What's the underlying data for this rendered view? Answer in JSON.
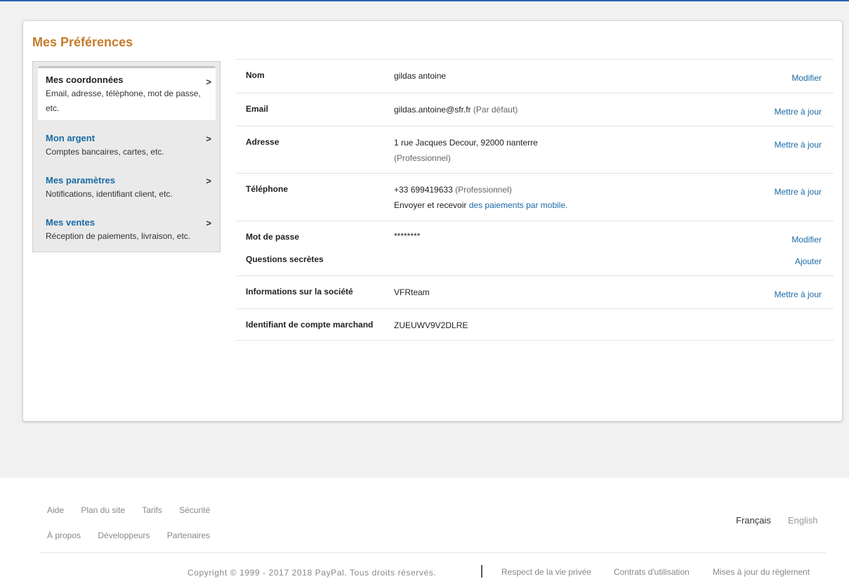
{
  "page": {
    "title": "Mes Préférences"
  },
  "sidebar": {
    "items": [
      {
        "title": "Mes coordonnées",
        "desc": "Email, adresse, téléphone, mot de passe, etc."
      },
      {
        "title": "Mon argent",
        "desc": "Comptes bancaires, cartes, etc."
      },
      {
        "title": "Mes paramètres",
        "desc": "Notifications, identifiant client, etc."
      },
      {
        "title": "Mes ventes",
        "desc": "Réception de paiements, livraison, etc."
      }
    ],
    "chevron": ">"
  },
  "details": {
    "nom": {
      "label": "Nom",
      "value": "gildas antoine",
      "action": "Modifier"
    },
    "email": {
      "label": "Email",
      "value": "gildas.antoine@sfr.fr",
      "note": "(Par défaut)",
      "action": "Mettre à jour"
    },
    "adresse": {
      "label": "Adresse",
      "value": "1 rue Jacques Decour, 92000 nanterre",
      "note": "(Professionnel)",
      "action": "Mettre à jour"
    },
    "telephone": {
      "label": "Téléphone",
      "value": "+33 699419633",
      "note": "(Professionnel)",
      "line2_prefix": "Envoyer et recevoir",
      "line2_link": "des paiements par mobile.",
      "action": "Mettre à jour"
    },
    "mdp": {
      "label": "Mot de passe",
      "value": "********",
      "action": "Modifier"
    },
    "questions": {
      "label": "Questions secrètes",
      "action": "Ajouter"
    },
    "societe": {
      "label": "Informations sur la société",
      "value": "VFRteam",
      "action": "Mettre à jour"
    },
    "marchand": {
      "label": "Identifiant de compte marchand",
      "value": "ZUEUWV9V2DLRE"
    }
  },
  "footer": {
    "links_row1": [
      "Aide",
      "Plan du site",
      "Tarifs",
      "Sécurité"
    ],
    "links_row2": [
      "À propos",
      "Développeurs",
      "Partenaires"
    ],
    "languages": [
      "Français",
      "English"
    ],
    "copyright": "Copyright © 1999 - 2017 2018 PayPal. Tous droits réservés.",
    "legal": [
      "Respect de la vie privée",
      "Contrats d'utilisation",
      "Mises à jour du règlement"
    ]
  },
  "colors": {
    "accent": "#c47c2b",
    "link": "#1a6aa6",
    "topbar": "#2d62b0"
  }
}
